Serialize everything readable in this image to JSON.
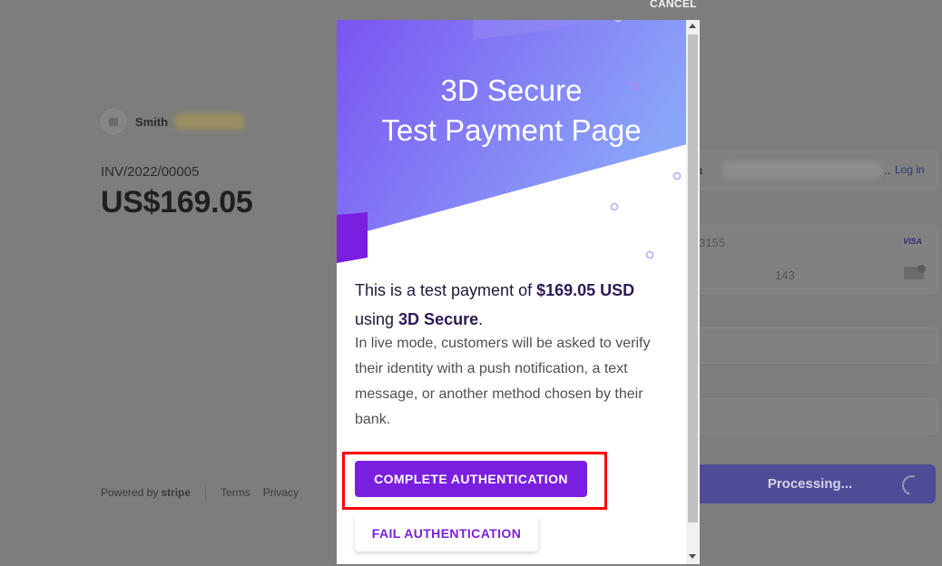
{
  "header": {
    "cancel_label": "CANCEL"
  },
  "merchant": {
    "name": "Smith"
  },
  "invoice": {
    "number": "INV/2022/00005",
    "amount": "US$169.05"
  },
  "footer": {
    "powered_by": "Powered by",
    "brand": "stripe",
    "terms": "Terms",
    "privacy": "Privacy"
  },
  "payment_form": {
    "email_fragment": "a",
    "dots": "..",
    "login_label": "Log in",
    "card_number_fragment": "3155",
    "card_brand": "VISA",
    "cvc": "143",
    "submit_label": "Processing..."
  },
  "modal": {
    "title_line1": "3D Secure",
    "title_line2": "Test Payment Page",
    "intro_prefix": "This is a test payment of ",
    "amount": "$169.05 USD",
    "using_prefix": "using ",
    "method": "3D Secure",
    "period": ".",
    "description": "In live mode, customers will be asked to verify their identity with a push notification, a text message, or another method chosen by their bank.",
    "complete_label": "COMPLETE AUTHENTICATION",
    "fail_label": "FAIL AUTHENTICATION"
  },
  "colors": {
    "accent": "#7a1fe0",
    "banner_gradient_start": "#7b5cf5",
    "banner_gradient_end": "#8aa0f8",
    "highlight": "#ff0000"
  }
}
